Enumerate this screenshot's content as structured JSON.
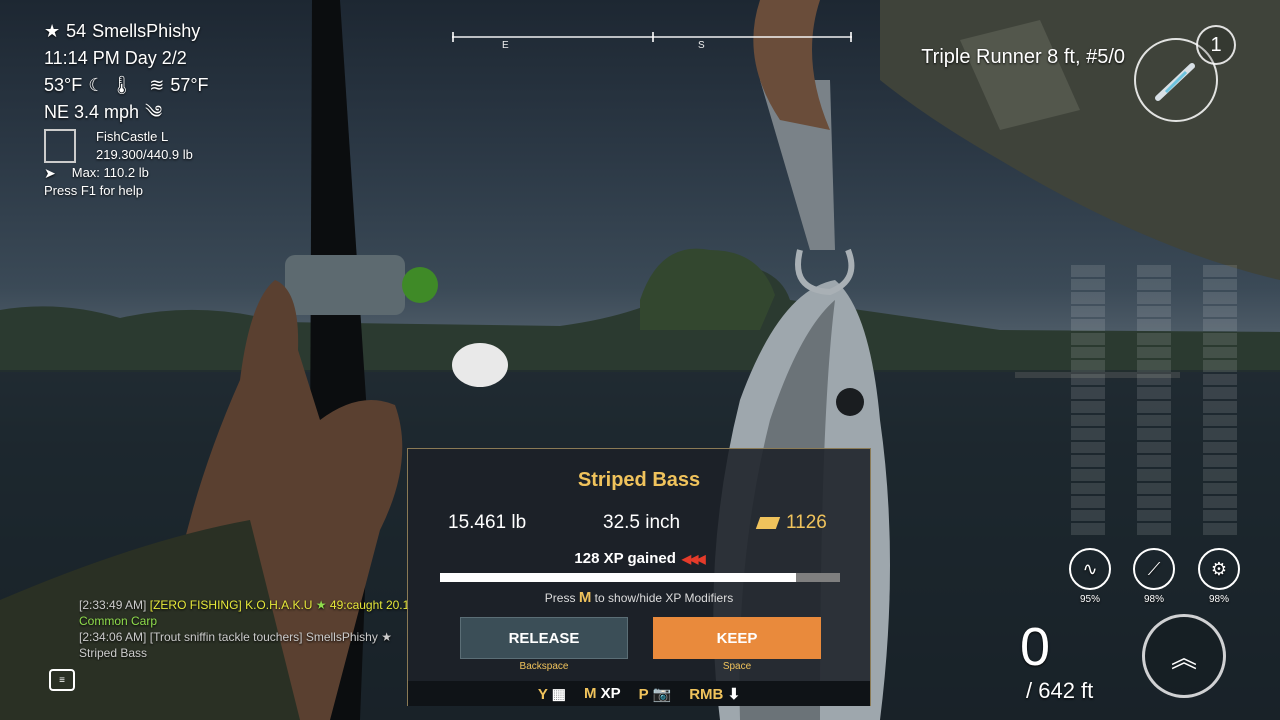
{
  "player": {
    "level": "54",
    "name": "SmellsPhishy",
    "time_day": "11:14 PM Day 2/2",
    "air_temp": "53°F",
    "water_temp": "57°F",
    "wind": "NE 3.4 mph",
    "keepnet_name": "FishCastle L",
    "keepnet_weight": "219.300/440.9 lb",
    "max_weight": "Max: 110.2 lb",
    "help": "Press F1 for help"
  },
  "compass": {
    "marks": [
      "E",
      "S"
    ]
  },
  "tackle": {
    "name": "Triple Runner 8 ft, #5/0",
    "rod_count": "1"
  },
  "catch": {
    "species": "Striped Bass",
    "weight": "15.461 lb",
    "length": "32.5 inch",
    "money": "1126",
    "xp": "128 XP gained",
    "xp_progress": 0.89,
    "modifier_hint_pre": "Press",
    "modifier_key": "M",
    "modifier_hint_post": "to show/hide XP Modifiers",
    "release_label": "RELEASE",
    "release_key": "Backspace",
    "keep_label": "KEEP",
    "keep_key": "Space"
  },
  "hotkeys": [
    {
      "key": "Y",
      "label": ""
    },
    {
      "key": "M",
      "label": "XP"
    },
    {
      "key": "P",
      "label": ""
    },
    {
      "key": "RMB",
      "label": ""
    }
  ],
  "gear": [
    {
      "icon": "line-icon",
      "value": "95%"
    },
    {
      "icon": "rod-icon",
      "value": "98%"
    },
    {
      "icon": "reel-icon",
      "value": "98%"
    }
  ],
  "line": {
    "count": "0",
    "length": "/ 642 ft"
  },
  "chat": [
    {
      "time": "[2:33:49 AM]",
      "team": "[ZERO FISHING]",
      "player": "K.O.H.A.K.U",
      "msg": "49:caught 20.1",
      "fish": "Common Carp"
    },
    {
      "time": "[2:34:06 AM]",
      "team": "[Trout sniffin tackle touchers]",
      "player": "SmellsPhishy",
      "msg": "",
      "fish": "Striped Bass"
    }
  ],
  "colors": {
    "accent": "#f0c35c",
    "keep": "#e98a3c",
    "release": "#3b4e57"
  }
}
